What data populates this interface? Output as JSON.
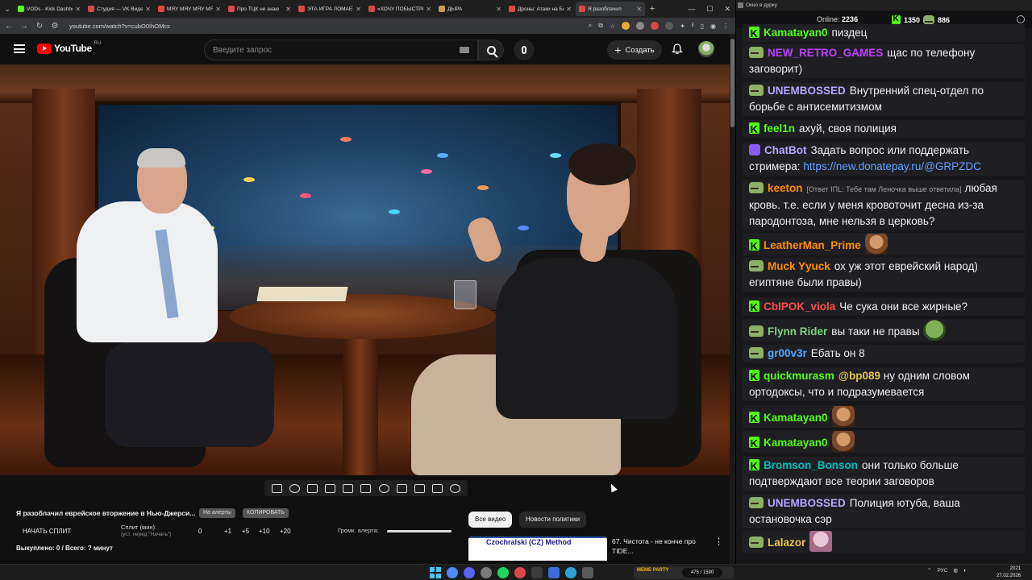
{
  "browser": {
    "tabs": [
      {
        "title": "VODs - Kick Dashboard",
        "color": "#53fc18",
        "active": false
      },
      {
        "title": "Студия — VK Видео",
        "color": "#e04848",
        "active": false
      },
      {
        "title": "МЯУ МЯУ МЯУ МЯУ",
        "color": "#e04848",
        "active": false
      },
      {
        "title": "Про ТЦК не знаю",
        "color": "#e04848",
        "active": false
      },
      {
        "title": "ЭТА ИГРА ЛОМАЕТ",
        "color": "#e04848",
        "active": false
      },
      {
        "title": "«ХОЧУ ПОБЫСТРЕЕ»",
        "color": "#e04848",
        "active": false
      },
      {
        "title": "ДЫРА",
        "color": "#c89a52",
        "active": false
      },
      {
        "title": "Дроны: Атаки на Бел",
        "color": "#e04848",
        "active": false
      },
      {
        "title": "Я разоблачил",
        "color": "#e04848",
        "active": true
      }
    ],
    "url": "youtube.com/watch?v=cubO0IhOMcs"
  },
  "youtube": {
    "logo_text": "YouTube",
    "logo_region": "RU",
    "search_placeholder": "Введите запрос",
    "create_label": "Создать"
  },
  "split_panel": {
    "title": "Я разоблачил еврейское вторжение в Нью-Джерси...",
    "chip_alert": "На алерты",
    "chip_copy": "КОПИРОВАТЬ",
    "start_split": "НАЧАТЬ СПЛИТ",
    "split_label": "Сплит (мин):",
    "split_sub": "(уст. перед \"Начать\")",
    "values": [
      "0",
      "+1",
      "+5",
      "+10",
      "+20"
    ],
    "volume_label": "Громк. алерта:",
    "volume_level": 1.0,
    "sold": "Выкуплено: 0 / Всего: ? минут"
  },
  "recommendations": {
    "chip_all": "Все видео",
    "chip_politics": "Новости политики",
    "thumb_title": "Czochralski (CZ) Method",
    "video_title": "67. Чистота - не конче про TIDE..."
  },
  "chat": {
    "window_title": "Окно в дурку",
    "online_label": "Online:",
    "online_count": "2236",
    "kick_count": "1350",
    "other_count": "886",
    "messages": [
      {
        "badge": "kick",
        "nick": "Kamatayan0",
        "color": "#53fc18",
        "text": "пиздец"
      },
      {
        "badge": "frog",
        "nick": "NEW_RETRO_GAMES",
        "color": "#bf40ff",
        "text": "щас по телефону заговорит)"
      },
      {
        "badge": "frog",
        "nick": "UNEMBOSSED",
        "color": "#b7a7ff",
        "text": "Внутренний спец-отдел по борьбе с антисемитизмом"
      },
      {
        "badge": "kick",
        "nick": "feel1n",
        "color": "#53fc18",
        "text": "ахуй, своя полиция"
      },
      {
        "badge": "bot",
        "nick": "ChatBot",
        "color": "#b7a7ff",
        "text": "Задать вопрос или поддержать стримера:",
        "link": "https://new.donatepay.ru/@GRPZDC"
      },
      {
        "badge": "frog",
        "nick": "keeton",
        "color": "#ff8c00",
        "reply": "[Ответ IПL: Тебе там Леночка выше ответила]",
        "text": "любая кровь. т.е. если у меня кровоточит десна из-за пародонтоза, мне нельзя в церковь?"
      },
      {
        "badge": "kick",
        "nick": "LeatherMan_Prime",
        "color": "#ff8c00",
        "text": "",
        "emote": "face-brown"
      },
      {
        "badge": "frog",
        "nick": "Muck Yyuck",
        "color": "#ff8c00",
        "text": "ох уж этот еврейский народ) египтяне были правы)"
      },
      {
        "badge": "kick",
        "nick": "CbIPOK_viola",
        "color": "#ff4d4d",
        "text": "Че сука они все жирные?"
      },
      {
        "badge": "frog",
        "nick": "Flynn Rider",
        "color": "#7cd37c",
        "text": "вы таки не правы",
        "emote": "pepe"
      },
      {
        "badge": "frog",
        "nick": "gr00v3r",
        "color": "#4aa8ff",
        "text": "Ебать он 8"
      },
      {
        "badge": "kick",
        "nick": "quickmurasm",
        "color": "#53fc18",
        "mention": "@bp089",
        "text": "ну одним словом ортодоксы, что и подразумевается"
      },
      {
        "badge": "kick",
        "nick": "Kamatayan0",
        "color": "#53fc18",
        "text": "",
        "emote": "face-brown"
      },
      {
        "badge": "kick",
        "nick": "Kamatayan0",
        "color": "#53fc18",
        "text": "",
        "emote": "face-brown"
      },
      {
        "badge": "kick",
        "nick": "Bromson_Bonson",
        "color": "#00bfbf",
        "text": "они только больше подтверждают все теории заговоров"
      },
      {
        "badge": "frog",
        "nick": "UNEMBOSSED",
        "color": "#b7a7ff",
        "text": "Полиция ютуба, ваша остановочка сэр"
      },
      {
        "badge": "frog",
        "nick": "Lalazor",
        "color": "#e5c54a",
        "text": "",
        "emote": "face-pink"
      }
    ]
  },
  "taskbar": {
    "media_label": "MEME PARTY",
    "media_counter": "475 / 1590",
    "tray_lang": "РУС",
    "time": "2021",
    "date": "27.02.2026"
  }
}
